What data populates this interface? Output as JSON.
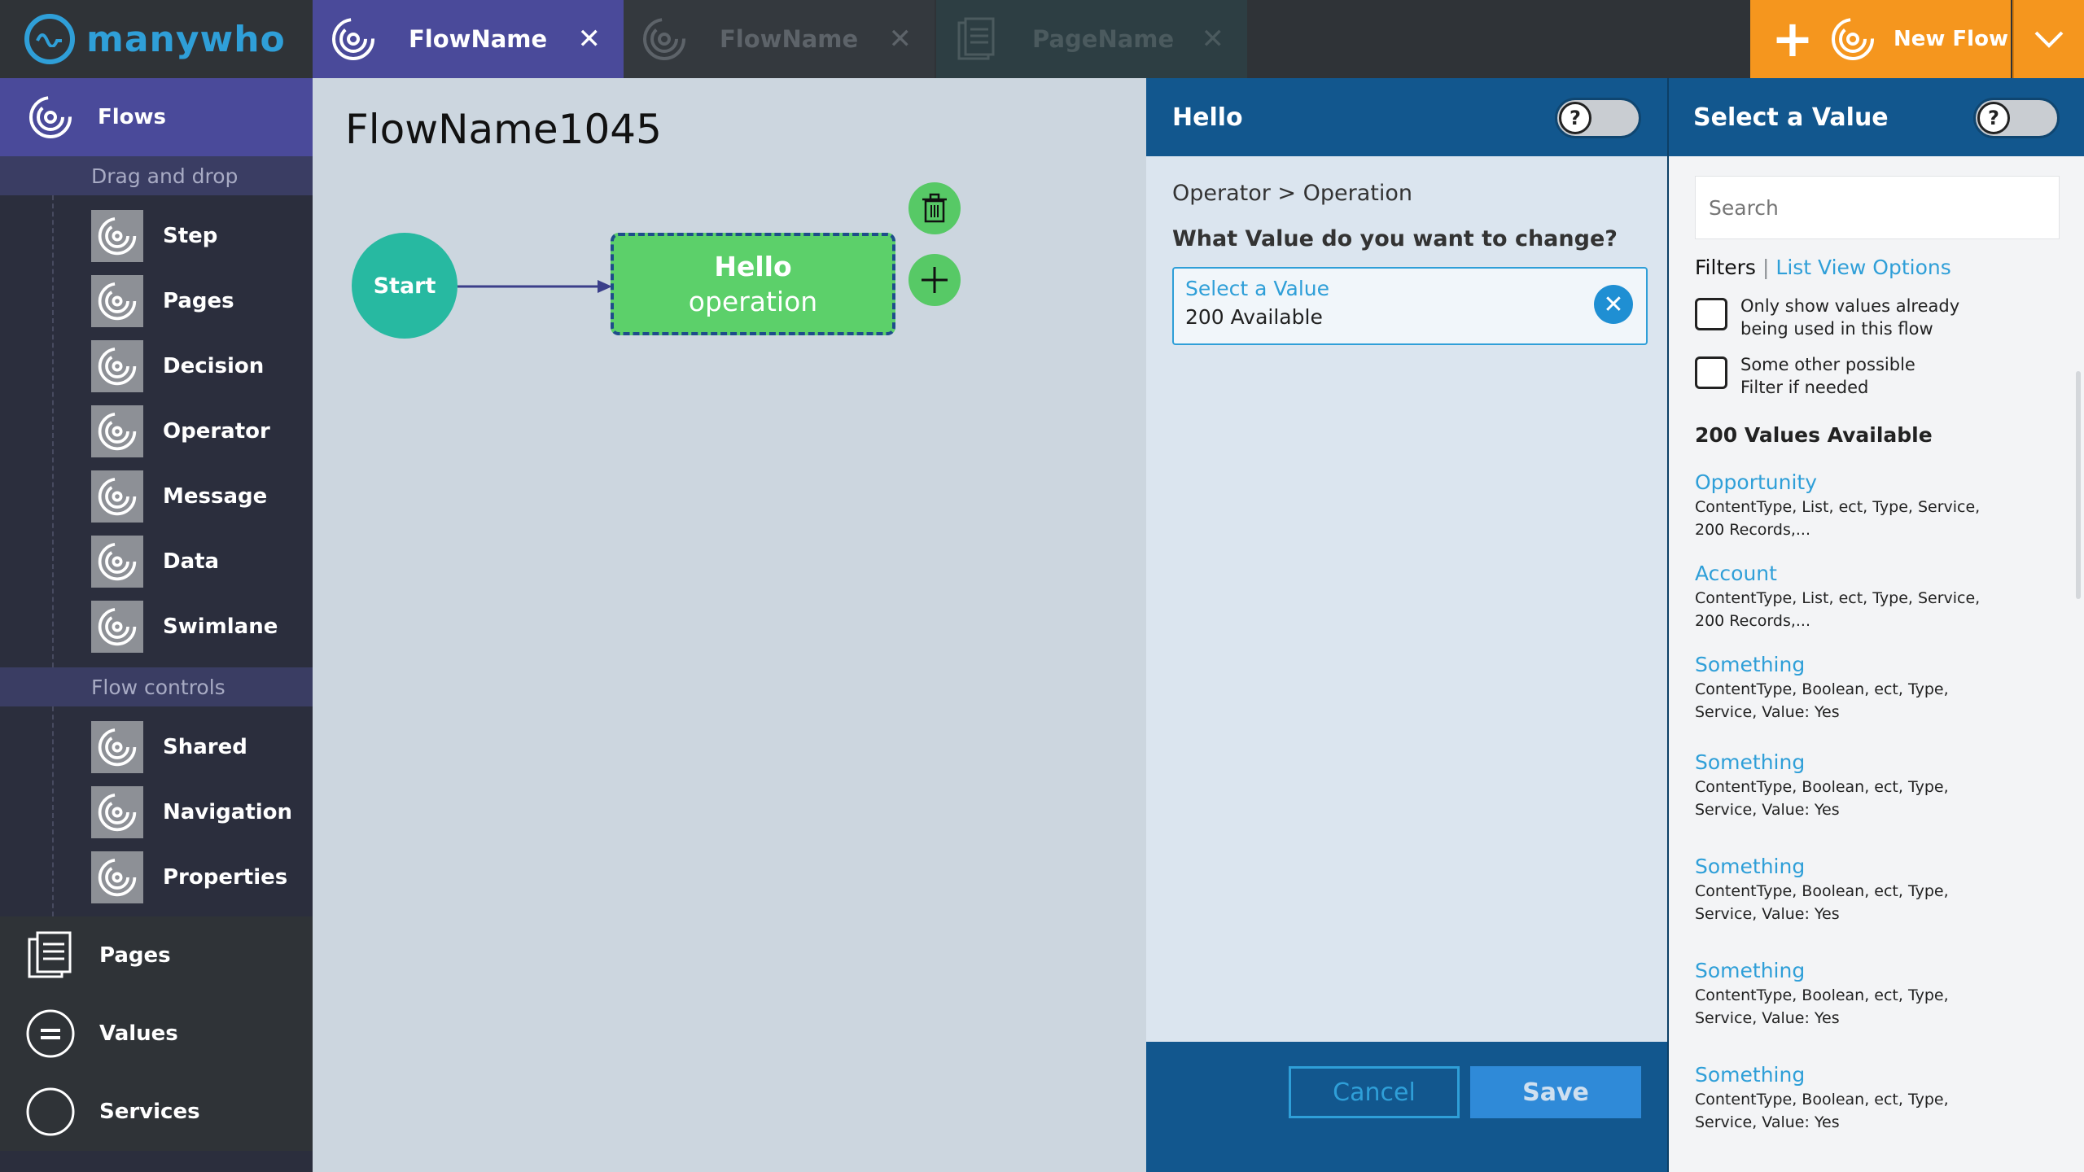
{
  "app": {
    "logo_text": "manywho"
  },
  "tabs": [
    {
      "label": "FlowName",
      "icon": "flow-icon",
      "state": "active"
    },
    {
      "label": "FlowName",
      "icon": "flow-icon",
      "state": "inactive"
    },
    {
      "label": "PageName",
      "icon": "page-icon",
      "state": "inactive"
    }
  ],
  "tab_close_glyph": "✕",
  "new_flow": {
    "label": "New Flow"
  },
  "sidebar": {
    "flows_label": "Flows",
    "drag_drop_label": "Drag and drop",
    "drag_drop_items": [
      "Step",
      "Pages",
      "Decision",
      "Operator",
      "Message",
      "Data",
      "Swimlane"
    ],
    "flow_controls_label": "Flow controls",
    "flow_control_items": [
      "Shared",
      "Navigation",
      "Properties"
    ],
    "nav": [
      {
        "label": "Pages",
        "icon": "pages-icon"
      },
      {
        "label": "Values",
        "icon": "values-icon"
      },
      {
        "label": "Services",
        "icon": "services-icon"
      }
    ]
  },
  "canvas": {
    "title": "FlowName1045",
    "start_label": "Start",
    "node": {
      "title": "Hello",
      "subtitle": "operation"
    }
  },
  "config": {
    "title": "Hello",
    "help_glyph": "?",
    "breadcrumb": "Operator > Operation",
    "question": "What Value do you want to change?",
    "value_label": "Select a Value",
    "value_count": "200 Available",
    "cancel_label": "Cancel",
    "save_label": "Save"
  },
  "select_panel": {
    "title": "Select a Value",
    "help_glyph": "?",
    "search_placeholder": "Search",
    "filters_label": "Filters",
    "list_view_label": "List View Options",
    "checkboxes": [
      {
        "label_line1": "Only show values already",
        "label_line2": "being used in this flow"
      },
      {
        "label_line1": "Some other possible",
        "label_line2": "Filter if needed"
      }
    ],
    "count_label": "200 Values Available",
    "results": [
      {
        "title": "Opportunity",
        "line1": "ContentType, List, ect, Type, Service,",
        "line2": "200 Records,..."
      },
      {
        "title": "Account",
        "line1": "ContentType, List, ect, Type, Service,",
        "line2": "200 Records,..."
      },
      {
        "title": "Something",
        "line1": "ContentType, Boolean, ect, Type,",
        "line2": "Service, Value: Yes"
      },
      {
        "title": "Something",
        "line1": "ContentType, Boolean, ect, Type,",
        "line2": "Service, Value: Yes"
      },
      {
        "title": "Something",
        "line1": "ContentType, Boolean, ect, Type,",
        "line2": "Service, Value: Yes"
      },
      {
        "title": "Something",
        "line1": "ContentType, Boolean, ect, Type,",
        "line2": "Service, Value: Yes"
      },
      {
        "title": "Something",
        "line1": "ContentType, Boolean, ect, Type,",
        "line2": "Service, Value: Yes"
      }
    ]
  },
  "colors": {
    "topbar": "#2f3337",
    "brand_blue": "#2f9fd8",
    "tab_active": "#4a4a9a",
    "new_flow_orange": "#f5961e",
    "panel_header": "#12578e",
    "node_green": "#5cd06a",
    "start_teal": "#27b9a1"
  }
}
